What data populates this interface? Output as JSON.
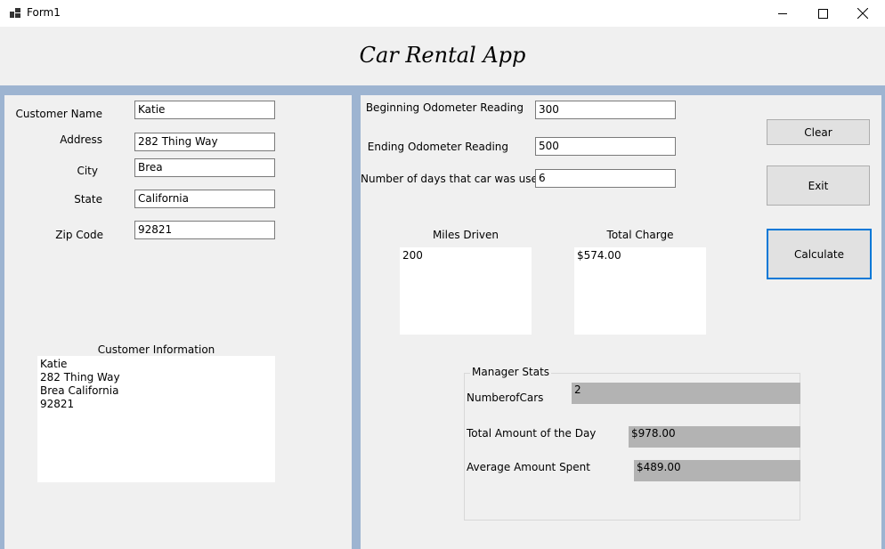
{
  "window": {
    "title": "Form1"
  },
  "header": {
    "title": "Car Rental App"
  },
  "customer": {
    "name_label": "Customer Name",
    "name_value": "Katie",
    "address_label": "Address",
    "address_value": "282 Thing Way",
    "city_label": "City",
    "city_value": "Brea",
    "state_label": "State",
    "state_value": "California",
    "zip_label": "Zip Code",
    "zip_value": "92821",
    "info_label": "Customer Information",
    "info_text": "Katie\n282 Thing Way\nBrea California\n92821"
  },
  "odometer": {
    "begin_label": "Beginning Odometer Reading",
    "begin_value": "300",
    "end_label": "Ending Odometer Reading",
    "end_value": "500",
    "days_label": "Number of days that car was used",
    "days_value": "6"
  },
  "results": {
    "miles_label": "Miles Driven",
    "miles_value": "200",
    "charge_label": "Total Charge",
    "charge_value": "$574.00"
  },
  "buttons": {
    "clear": "Clear",
    "exit": "Exit",
    "calculate": "Calculate"
  },
  "manager": {
    "title": "Manager Stats",
    "cars_label": "NumberofCars",
    "cars_value": "2",
    "total_label": "Total Amount of the Day",
    "total_value": "$978.00",
    "avg_label": "Average Amount Spent",
    "avg_value": "$489.00"
  },
  "colors": {
    "band": "#9db4d1",
    "form_bg": "#f0f0f0",
    "accent": "#0078d7"
  }
}
